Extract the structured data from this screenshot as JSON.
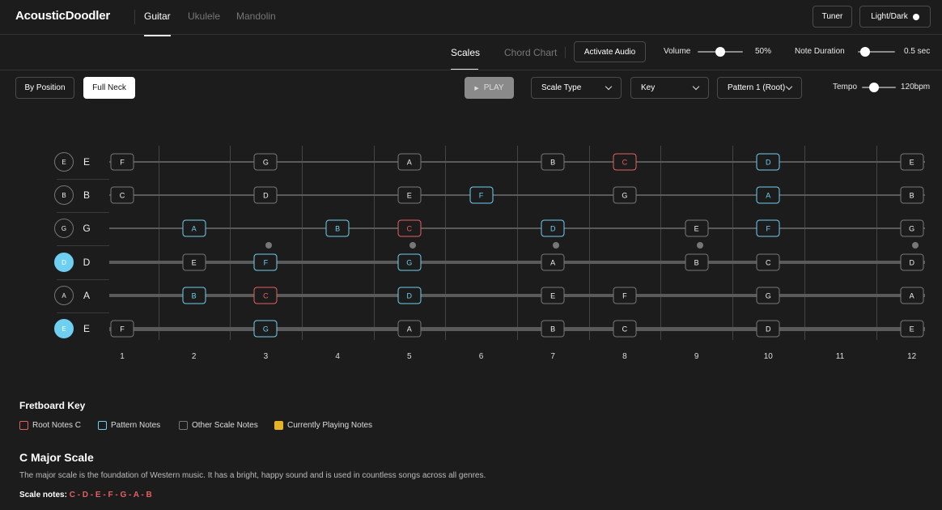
{
  "app": {
    "title": "AcousticDoodler"
  },
  "header": {
    "tabs": [
      {
        "label": "Guitar"
      },
      {
        "label": "Ukulele"
      },
      {
        "label": "Mandolin"
      }
    ],
    "tuner_label": "Tuner",
    "theme_label": "Light/Dark"
  },
  "toolbar": {
    "subtabs": [
      {
        "label": "Scales"
      },
      {
        "label": "Chord Chart"
      }
    ],
    "activate_audio_label": "Activate Audio",
    "volume_label": "Volume",
    "volume_value": "50%",
    "volume_level": 0.5,
    "duration_label": "Note Duration",
    "duration_value": "0.5 sec",
    "duration_level": 0.1
  },
  "controls": {
    "by_position_label": "By Position",
    "full_neck_label": "Full Neck",
    "play_label": "PLAY",
    "scale_type_label": "Scale Type",
    "key_label": "Key",
    "pattern_label": "Pattern 1 (Root)",
    "tempo_label": "Tempo",
    "tempo_value": "120bpm",
    "tempo_level": 0.3
  },
  "fretboard": {
    "frets": [
      "1",
      "2",
      "3",
      "4",
      "5",
      "6",
      "7",
      "8",
      "9",
      "10",
      "11",
      "12"
    ],
    "inlays": [
      3,
      5,
      7,
      9,
      12
    ],
    "strings": [
      {
        "open": "E",
        "name": "E",
        "highlight": false,
        "thickness": 1,
        "notes": [
          {
            "fret": 1,
            "n": "F",
            "t": "o"
          },
          {
            "fret": 3,
            "n": "G",
            "t": "o"
          },
          {
            "fret": 5,
            "n": "A",
            "t": "o"
          },
          {
            "fret": 7,
            "n": "B",
            "t": "o"
          },
          {
            "fret": 8,
            "n": "C",
            "t": "r"
          },
          {
            "fret": 10,
            "n": "D",
            "t": "p"
          },
          {
            "fret": 12,
            "n": "E",
            "t": "o"
          }
        ]
      },
      {
        "open": "B",
        "name": "B",
        "highlight": false,
        "thickness": 1,
        "notes": [
          {
            "fret": 1,
            "n": "C",
            "t": "o"
          },
          {
            "fret": 3,
            "n": "D",
            "t": "o"
          },
          {
            "fret": 5,
            "n": "E",
            "t": "o"
          },
          {
            "fret": 6,
            "n": "F",
            "t": "p"
          },
          {
            "fret": 8,
            "n": "G",
            "t": "o"
          },
          {
            "fret": 10,
            "n": "A",
            "t": "p"
          },
          {
            "fret": 12,
            "n": "B",
            "t": "o"
          }
        ]
      },
      {
        "open": "G",
        "name": "G",
        "highlight": false,
        "thickness": 2,
        "notes": [
          {
            "fret": 2,
            "n": "A",
            "t": "p"
          },
          {
            "fret": 4,
            "n": "B",
            "t": "p"
          },
          {
            "fret": 5,
            "n": "C",
            "t": "r"
          },
          {
            "fret": 7,
            "n": "D",
            "t": "p"
          },
          {
            "fret": 9,
            "n": "E",
            "t": "o"
          },
          {
            "fret": 10,
            "n": "F",
            "t": "p"
          },
          {
            "fret": 12,
            "n": "G",
            "t": "o"
          }
        ]
      },
      {
        "open": "D",
        "name": "D",
        "highlight": true,
        "thickness": 3,
        "notes": [
          {
            "fret": 2,
            "n": "E",
            "t": "o"
          },
          {
            "fret": 3,
            "n": "F",
            "t": "p"
          },
          {
            "fret": 5,
            "n": "G",
            "t": "p"
          },
          {
            "fret": 7,
            "n": "A",
            "t": "o"
          },
          {
            "fret": 9,
            "n": "B",
            "t": "o"
          },
          {
            "fret": 10,
            "n": "C",
            "t": "o"
          },
          {
            "fret": 12,
            "n": "D",
            "t": "o"
          }
        ]
      },
      {
        "open": "A",
        "name": "A",
        "highlight": false,
        "thickness": 4,
        "notes": [
          {
            "fret": 2,
            "n": "B",
            "t": "p"
          },
          {
            "fret": 3,
            "n": "C",
            "t": "r"
          },
          {
            "fret": 5,
            "n": "D",
            "t": "p"
          },
          {
            "fret": 7,
            "n": "E",
            "t": "o"
          },
          {
            "fret": 8,
            "n": "F",
            "t": "o"
          },
          {
            "fret": 10,
            "n": "G",
            "t": "o"
          },
          {
            "fret": 12,
            "n": "A",
            "t": "o"
          }
        ]
      },
      {
        "open": "E",
        "name": "E",
        "highlight": true,
        "thickness": 5,
        "notes": [
          {
            "fret": 1,
            "n": "F",
            "t": "o"
          },
          {
            "fret": 3,
            "n": "G",
            "t": "p"
          },
          {
            "fret": 5,
            "n": "A",
            "t": "o"
          },
          {
            "fret": 7,
            "n": "B",
            "t": "o"
          },
          {
            "fret": 8,
            "n": "C",
            "t": "o"
          },
          {
            "fret": 10,
            "n": "D",
            "t": "o"
          },
          {
            "fret": 12,
            "n": "E",
            "t": "o"
          }
        ]
      }
    ]
  },
  "legend": {
    "title": "Fretboard Key",
    "items": [
      {
        "label": "Root Notes C",
        "color": "#e36060"
      },
      {
        "label": "Pattern Notes",
        "color": "#6fcff0"
      },
      {
        "label": "Other Scale Notes",
        "color": "#777777"
      },
      {
        "label": "Currently Playing Notes",
        "color": "#e6b422"
      }
    ]
  },
  "scale": {
    "title": "C Major Scale",
    "description": "The major scale is the foundation of Western music. It has a bright, happy sound and is used in countless songs across all genres.",
    "notes_label": "Scale notes:",
    "notes_value": "C - D - E - F - G - A - B"
  },
  "colors": {
    "root": "#e36060",
    "pattern": "#6fcff0",
    "playing": "#e6b422",
    "accent_open": "#6fcff0"
  }
}
